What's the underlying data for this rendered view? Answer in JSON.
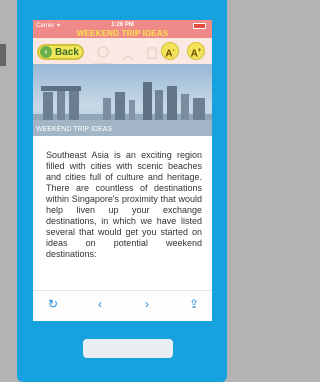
{
  "status": {
    "carrier": "Carrier ✦",
    "time": "1:26 PM"
  },
  "header": {
    "title": "WEEKEND TRIP IDEAS",
    "back_label": "Back",
    "font_down": "A",
    "font_up": "A"
  },
  "hero": {
    "caption": "WEEKEND TRIP IDEAS"
  },
  "article": {
    "text": "Southeast Asia is an exciting region filled with cities with scenic beaches and cities full of culture and heritage. There are countless of destinations within Singapore's proximity that would help liven up your exchange destinations, in which we have listed several that would get you started on ideas on potential weekend destinations:"
  },
  "toolbar": {
    "icons": [
      "refresh-icon",
      "back-chevron-icon",
      "forward-chevron-icon",
      "share-icon"
    ]
  },
  "colors": {
    "phone_frame": "#15a2df",
    "header_bg": "#f08a88",
    "title_yellow": "#f7e24a",
    "link_blue": "#1a8be0"
  }
}
